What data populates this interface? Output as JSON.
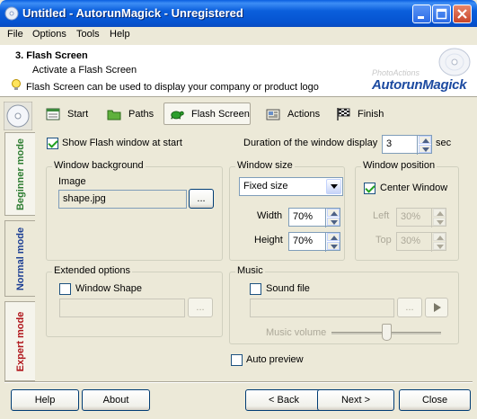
{
  "window": {
    "title": "Untitled - AutorunMagick - Unregistered"
  },
  "menu": [
    "File",
    "Options",
    "Tools",
    "Help"
  ],
  "header": {
    "step_title": "3. Flash Screen",
    "step_subtitle": "Activate a Flash Screen",
    "hint": "Flash Screen can be used to display your company or product logo",
    "logo_top": "PhotoActions",
    "logo_main": "AutorunMagick"
  },
  "modes": {
    "beginner": "Beginner mode",
    "normal": "Normal mode",
    "expert": "Expert mode",
    "active": "normal"
  },
  "tabs": [
    {
      "label": "Start",
      "icon": "start-flag-icon"
    },
    {
      "label": "Paths",
      "icon": "folder-icon"
    },
    {
      "label": "Flash Screen",
      "icon": "turtle-icon",
      "active": true
    },
    {
      "label": "Actions",
      "icon": "actions-icon"
    },
    {
      "label": "Finish",
      "icon": "checkered-flag-icon"
    }
  ],
  "flash": {
    "show_label": "Show Flash window at start",
    "show_checked": true,
    "duration_label": "Duration of the window display",
    "duration_value": "3",
    "duration_unit": "sec"
  },
  "background_group": {
    "title": "Window background",
    "image_label": "Image",
    "image_value": "shape.jpg",
    "browse_label": "..."
  },
  "size_group": {
    "title": "Window size",
    "mode_value": "Fixed size",
    "width_label": "Width",
    "width_value": "70%",
    "height_label": "Height",
    "height_value": "70%"
  },
  "position_group": {
    "title": "Window position",
    "center_label": "Center Window",
    "center_checked": true,
    "left_label": "Left",
    "left_value": "30%",
    "top_label": "Top",
    "top_value": "30%"
  },
  "extended_group": {
    "title": "Extended options",
    "shape_label": "Window Shape",
    "shape_checked": false,
    "browse_label": "..."
  },
  "music_group": {
    "title": "Music",
    "sound_label": "Sound file",
    "sound_checked": false,
    "browse_label": "...",
    "volume_label": "Music volume",
    "volume_level": 0.5
  },
  "auto_preview": {
    "label": "Auto preview",
    "checked": false
  },
  "buttons": {
    "help": "Help",
    "about": "About",
    "back": "< Back",
    "next": "Next >",
    "close": "Close"
  },
  "colors": {
    "titlebar": "#0b5fdc",
    "logo": "#1c4aa0",
    "beginner": "#2e7d32",
    "normal": "#1c3f94",
    "expert": "#b0151b"
  }
}
